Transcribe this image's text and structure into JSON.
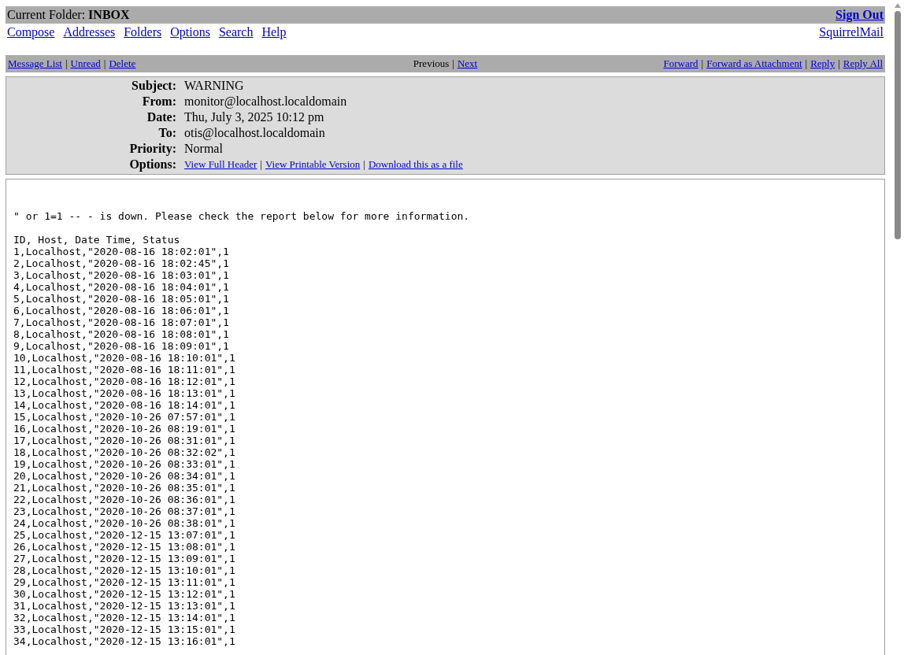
{
  "top_bar": {
    "label": "Current Folder:",
    "folder": "INBOX",
    "sign_out": "Sign Out"
  },
  "menu": [
    "Compose",
    "Addresses",
    "Folders",
    "Options",
    "Search",
    "Help"
  ],
  "brand": "SquirrelMail",
  "separator": "|",
  "message_nav": {
    "left": [
      "Message List",
      "Unread",
      "Delete"
    ],
    "center": [
      {
        "label": "Previous",
        "disabled": true
      },
      {
        "label": "Next",
        "disabled": false
      }
    ],
    "right": [
      "Forward",
      "Forward as Attachment",
      "Reply",
      "Reply All"
    ]
  },
  "headers": [
    {
      "label": "Subject:",
      "value": "WARNING"
    },
    {
      "label": "From:",
      "value": "monitor@localhost.localdomain"
    },
    {
      "label": "Date:",
      "value": "Thu, July 3, 2025 10:12 pm"
    },
    {
      "label": "To:",
      "value": "otis@localhost.localdomain"
    },
    {
      "label": "Priority:",
      "value": "Normal"
    }
  ],
  "options": {
    "label": "Options:",
    "links": [
      "View Full Header",
      "View Printable Version",
      "Download this as a file"
    ]
  },
  "body_lines": [
    "\" or 1=1 -- - is down. Please check the report below for more information.",
    "ID, Host, Date Time, Status",
    "1,Localhost,\"2020-08-16 18:02:01\",1",
    "2,Localhost,\"2020-08-16 18:02:45\",1",
    "3,Localhost,\"2020-08-16 18:03:01\",1",
    "4,Localhost,\"2020-08-16 18:04:01\",1",
    "5,Localhost,\"2020-08-16 18:05:01\",1",
    "6,Localhost,\"2020-08-16 18:06:01\",1",
    "7,Localhost,\"2020-08-16 18:07:01\",1",
    "8,Localhost,\"2020-08-16 18:08:01\",1",
    "9,Localhost,\"2020-08-16 18:09:01\",1",
    "10,Localhost,\"2020-08-16 18:10:01\",1",
    "11,Localhost,\"2020-08-16 18:11:01\",1",
    "12,Localhost,\"2020-08-16 18:12:01\",1",
    "13,Localhost,\"2020-08-16 18:13:01\",1",
    "14,Localhost,\"2020-08-16 18:14:01\",1",
    "15,Localhost,\"2020-10-26 07:57:01\",1",
    "16,Localhost,\"2020-10-26 08:19:01\",1",
    "17,Localhost,\"2020-10-26 08:31:01\",1",
    "18,Localhost,\"2020-10-26 08:32:02\",1",
    "19,Localhost,\"2020-10-26 08:33:01\",1",
    "20,Localhost,\"2020-10-26 08:34:01\",1",
    "21,Localhost,\"2020-10-26 08:35:01\",1",
    "22,Localhost,\"2020-10-26 08:36:01\",1",
    "23,Localhost,\"2020-10-26 08:37:01\",1",
    "24,Localhost,\"2020-10-26 08:38:01\",1",
    "25,Localhost,\"2020-12-15 13:07:01\",1",
    "26,Localhost,\"2020-12-15 13:08:01\",1",
    "27,Localhost,\"2020-12-15 13:09:01\",1",
    "28,Localhost,\"2020-12-15 13:10:01\",1",
    "29,Localhost,\"2020-12-15 13:11:01\",1",
    "30,Localhost,\"2020-12-15 13:12:01\",1",
    "31,Localhost,\"2020-12-15 13:13:01\",1",
    "32,Localhost,\"2020-12-15 13:14:01\",1",
    "33,Localhost,\"2020-12-15 13:15:01\",1",
    "34,Localhost,\"2020-12-15 13:16:01\",1"
  ]
}
